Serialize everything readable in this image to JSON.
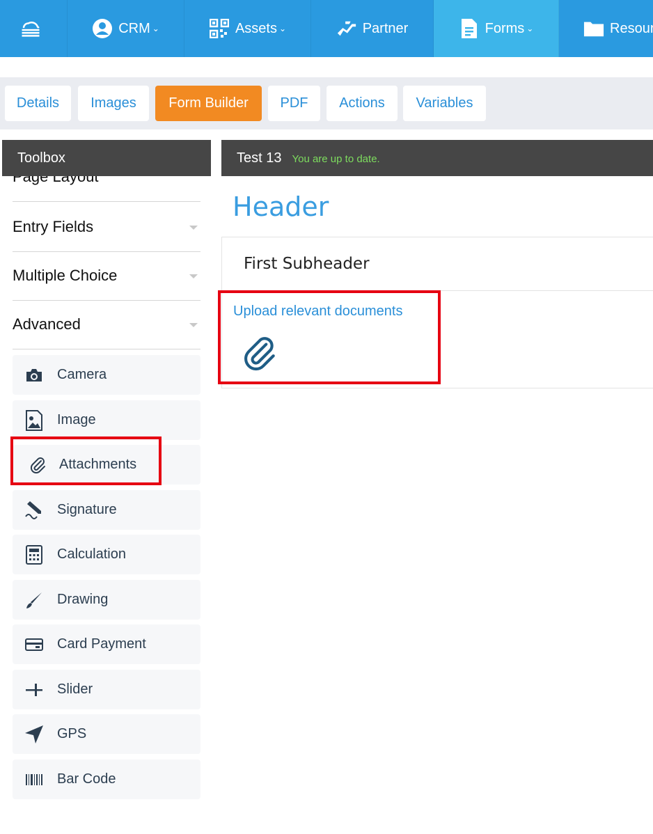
{
  "topnav": {
    "items": [
      {
        "label": "",
        "icon": "cloud-menu-icon"
      },
      {
        "label": "CRM",
        "icon": "user-circle-icon",
        "dropdown": true
      },
      {
        "label": "Assets",
        "icon": "qr-code-icon",
        "dropdown": true
      },
      {
        "label": "Partner",
        "icon": "handshake-icon",
        "dropdown": false
      },
      {
        "label": "Forms",
        "icon": "document-icon",
        "dropdown": true,
        "active": true
      },
      {
        "label": "Resour",
        "icon": "folder-icon",
        "dropdown": false
      }
    ]
  },
  "tabs": [
    {
      "label": "Details"
    },
    {
      "label": "Images"
    },
    {
      "label": "Form Builder",
      "active": true
    },
    {
      "label": "PDF"
    },
    {
      "label": "Actions"
    },
    {
      "label": "Variables"
    }
  ],
  "toolbox": {
    "title": "Toolbox",
    "sections": [
      {
        "label": "Page Layout"
      },
      {
        "label": "Entry Fields"
      },
      {
        "label": "Multiple Choice"
      },
      {
        "label": "Advanced"
      }
    ],
    "tools": [
      {
        "label": "Camera",
        "icon": "camera-icon"
      },
      {
        "label": "Image",
        "icon": "image-icon"
      },
      {
        "label": "Attachments",
        "icon": "paperclip-icon"
      },
      {
        "label": "Signature",
        "icon": "signature-icon"
      },
      {
        "label": "Calculation",
        "icon": "calculator-icon"
      },
      {
        "label": "Drawing",
        "icon": "brush-icon"
      },
      {
        "label": "Card Payment",
        "icon": "credit-card-icon"
      },
      {
        "label": "Slider",
        "icon": "slider-icon"
      },
      {
        "label": "GPS",
        "icon": "location-arrow-icon"
      },
      {
        "label": "Bar Code",
        "icon": "barcode-icon"
      }
    ]
  },
  "canvas": {
    "form_title": "Test 13",
    "status": "You are up to date.",
    "header": "Header",
    "subheader": "First Subheader",
    "attachment_field_label": "Upload relevant documents"
  },
  "colors": {
    "nav_bg": "#2a9ae0",
    "nav_active": "#3db5ea",
    "accent_orange": "#f28a22",
    "link_blue": "#2a8fd8",
    "highlight_red": "#e60012",
    "status_green": "#7ddc5e"
  }
}
